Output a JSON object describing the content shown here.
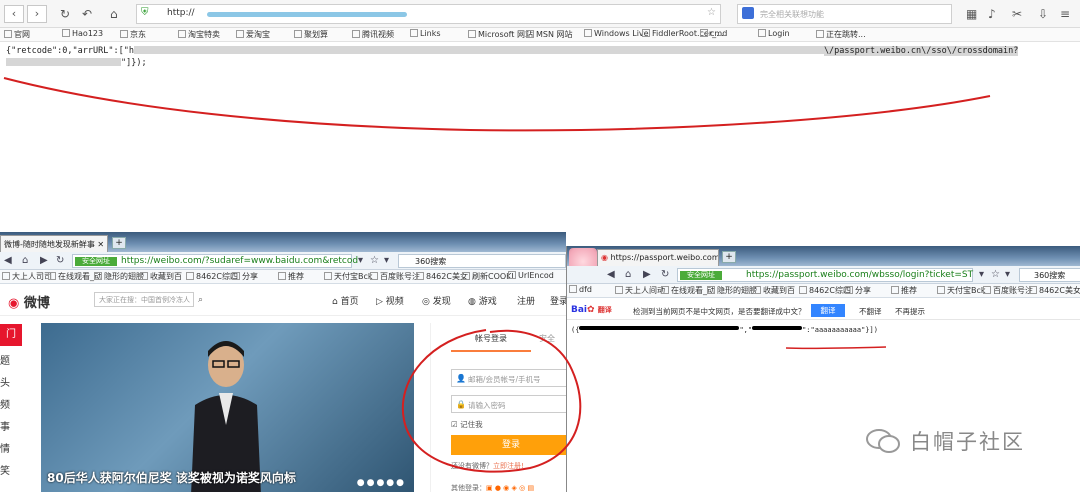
{
  "top_browser": {
    "url": "http://",
    "search_placeholder": "完全相关联想功能",
    "bookmarks": [
      "官网",
      "Hao123",
      "京东",
      "淘宝特卖",
      "爱淘宝",
      "聚划算",
      "腾讯视频",
      "Links",
      "Microsoft 网站",
      "MSN 网站",
      "Windows Live",
      "FiddlerRoot.cer_...",
      "cmd",
      "Login",
      "正在跳转..."
    ],
    "json_line1": "{\"retcode\":0,\"arrURL\":[\"h",
    "json_line1_tail": "\\/passport.weibo.cn\\/sso\\/crossdomain?",
    "json_line2": "\"]});"
  },
  "weibo_window": {
    "tab_title": "微博-随时随地发现新鲜事",
    "url": "https://weibo.com/?sudaref=www.baidu.com&retcod",
    "safe_badge": "安全网址",
    "search_engine": "360搜索",
    "bookmarks": [
      "大上人司司",
      "在线观看_动",
      "隐形的翅膀",
      "收藏到百",
      "8462C综四",
      "分享",
      "推荐",
      "天付宝Bck",
      "百度账号注",
      "8462C美女",
      "刷新COOKI",
      "UrlEncod"
    ],
    "logo": "微博",
    "search_placeholder": "大家正在搜：中国首例冷冻人",
    "nav": [
      "首页",
      "视频",
      "发现",
      "游戏",
      "注册",
      "登录"
    ],
    "side_items": [
      "门",
      "题",
      "头",
      "频",
      "事",
      "情",
      "笑"
    ],
    "photo_caption": "80后华人获阿尔伯尼奖 该奖被视为诺奖风向标",
    "login": {
      "tab_account": "帐号登录",
      "tab_other": "安全",
      "username_placeholder": "邮箱/会员帐号/手机号",
      "password_placeholder": "请输入密码",
      "remember": "记住我",
      "login_button": "登录",
      "signup_text": "还没有微博？",
      "signup_link": "立即注册!",
      "other_login": "其他登录："
    }
  },
  "passport_window": {
    "tab_title": "https://passport.weibo.com/",
    "url": "https://passport.weibo.com/wbsso/login?ticket=ST",
    "safe_badge": "安全网址",
    "search_engine": "360搜索",
    "bookmarks": [
      "dfd",
      "天上人间动",
      "在线观看_动",
      "隐形的翅膀",
      "收藏到百",
      "8462C综四",
      "分享",
      "推荐",
      "天付宝Bck",
      "百度账号注",
      "8462C美女"
    ],
    "translate_logo": "Bai",
    "translate_logo2": "翻译",
    "translate_message": "检测到当前网页不是中文网页，是否要翻译成中文？",
    "translate_button": "翻译",
    "no_translate": "不翻译",
    "never_prompt": "不再提示",
    "json_start": "({",
    "json_mid": "\",\"",
    "json_end": "\":\"aaaaaaaaaaa\"}])"
  },
  "watermark": "白帽子社区",
  "colors": {
    "scribble": "#d42020",
    "weibo_red": "#e6162d",
    "login_orange": "#ffa00a"
  }
}
